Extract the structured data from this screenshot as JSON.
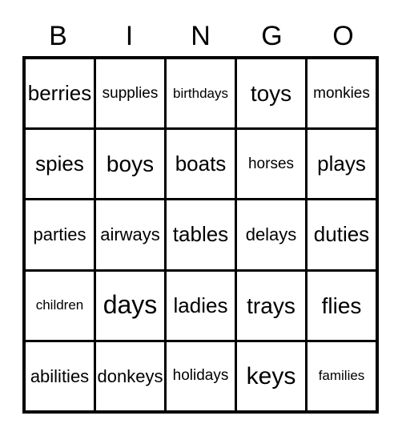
{
  "card": {
    "type": "bingo-card",
    "headers": [
      "B",
      "I",
      "N",
      "G",
      "O"
    ],
    "rows": [
      [
        {
          "text": "berries",
          "size": "fs-md"
        },
        {
          "text": "supplies",
          "size": "fs-xs"
        },
        {
          "text": "birthdays",
          "size": "fs-xxs"
        },
        {
          "text": "toys",
          "size": "fs-ml"
        },
        {
          "text": "monkies",
          "size": "fs-xs"
        }
      ],
      [
        {
          "text": "spies",
          "size": "fs-md"
        },
        {
          "text": "boys",
          "size": "fs-ml"
        },
        {
          "text": "boats",
          "size": "fs-md"
        },
        {
          "text": "horses",
          "size": "fs-xs"
        },
        {
          "text": "plays",
          "size": "fs-md"
        }
      ],
      [
        {
          "text": "parties",
          "size": "fs-sm"
        },
        {
          "text": "airways",
          "size": "fs-sm"
        },
        {
          "text": "tables",
          "size": "fs-md"
        },
        {
          "text": "delays",
          "size": "fs-sm"
        },
        {
          "text": "duties",
          "size": "fs-md"
        }
      ],
      [
        {
          "text": "children",
          "size": "fs-xxs"
        },
        {
          "text": "days",
          "size": "fs-xl"
        },
        {
          "text": "ladies",
          "size": "fs-md"
        },
        {
          "text": "trays",
          "size": "fs-ml"
        },
        {
          "text": "flies",
          "size": "fs-ml"
        }
      ],
      [
        {
          "text": "abilities",
          "size": "fs-sm"
        },
        {
          "text": "donkeys",
          "size": "fs-sm"
        },
        {
          "text": "holidays",
          "size": "fs-xs"
        },
        {
          "text": "keys",
          "size": "fs-lg"
        },
        {
          "text": "families",
          "size": "fs-xxs"
        }
      ]
    ],
    "colors": {
      "background": "#ffffff",
      "grid_line": "#000000",
      "text": "#000000"
    }
  }
}
